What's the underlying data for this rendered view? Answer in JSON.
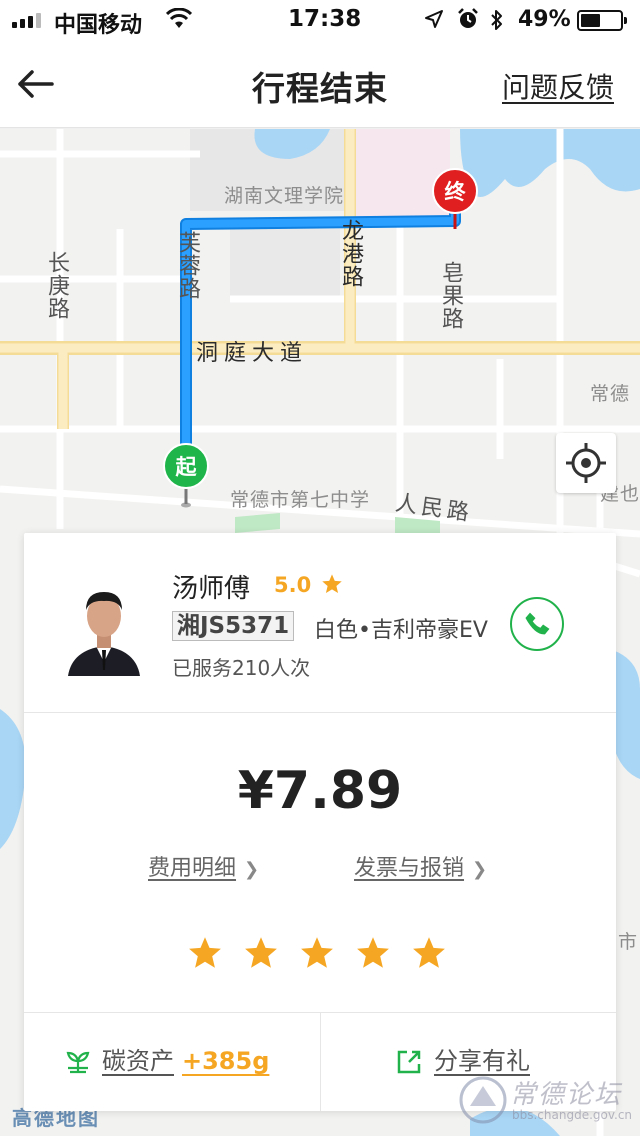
{
  "status_bar": {
    "carrier": "中国移动",
    "time": "17:38",
    "battery_percent": "49%",
    "battery_level": 0.49,
    "icons": [
      "signal-icon",
      "wifi-icon",
      "location-arrow-icon",
      "alarm-icon",
      "bluetooth-icon",
      "battery-icon"
    ]
  },
  "nav": {
    "title": "行程结束",
    "feedback": "问题反馈",
    "back_icon": "back-arrow-icon"
  },
  "map": {
    "labels": {
      "college": "湖南文理学院",
      "changkang_road": "长庚路",
      "furong_road": "芙蓉路",
      "longgang_road": "龙港路",
      "zaoguo_road": "皂果路",
      "dongting_avenue": "洞庭大道",
      "no7_school": "常德市第七中学",
      "renmin_road": "人民路",
      "changde_partial": "常德",
      "right_partial": "建也",
      "right_partial_2": "市",
      "brand": "高德地图"
    },
    "start_marker": "起",
    "end_marker": "终",
    "colors": {
      "route": "#1e90ff",
      "start": "#1fb54a",
      "end": "#e02020",
      "water": "#a9d6f5",
      "main_road": "#f9e5a8"
    }
  },
  "driver": {
    "name": "汤师傅",
    "rating": "5.0",
    "plate": "湘JS5371",
    "car": "白色•吉利帝豪EV",
    "served": "已服务210人次"
  },
  "fare": {
    "price": "¥7.89",
    "fee_detail": "费用明细",
    "invoice": "发票与报销",
    "star_rating": 5
  },
  "footer": {
    "carbon_label": "碳资产",
    "carbon_value": "+385g",
    "share_label": "分享有礼"
  },
  "watermark": {
    "text": "常德论坛",
    "url": "bbs.changde.gov.cn"
  },
  "colors": {
    "accent_green": "#21b24b",
    "accent_orange": "#f5a623"
  }
}
